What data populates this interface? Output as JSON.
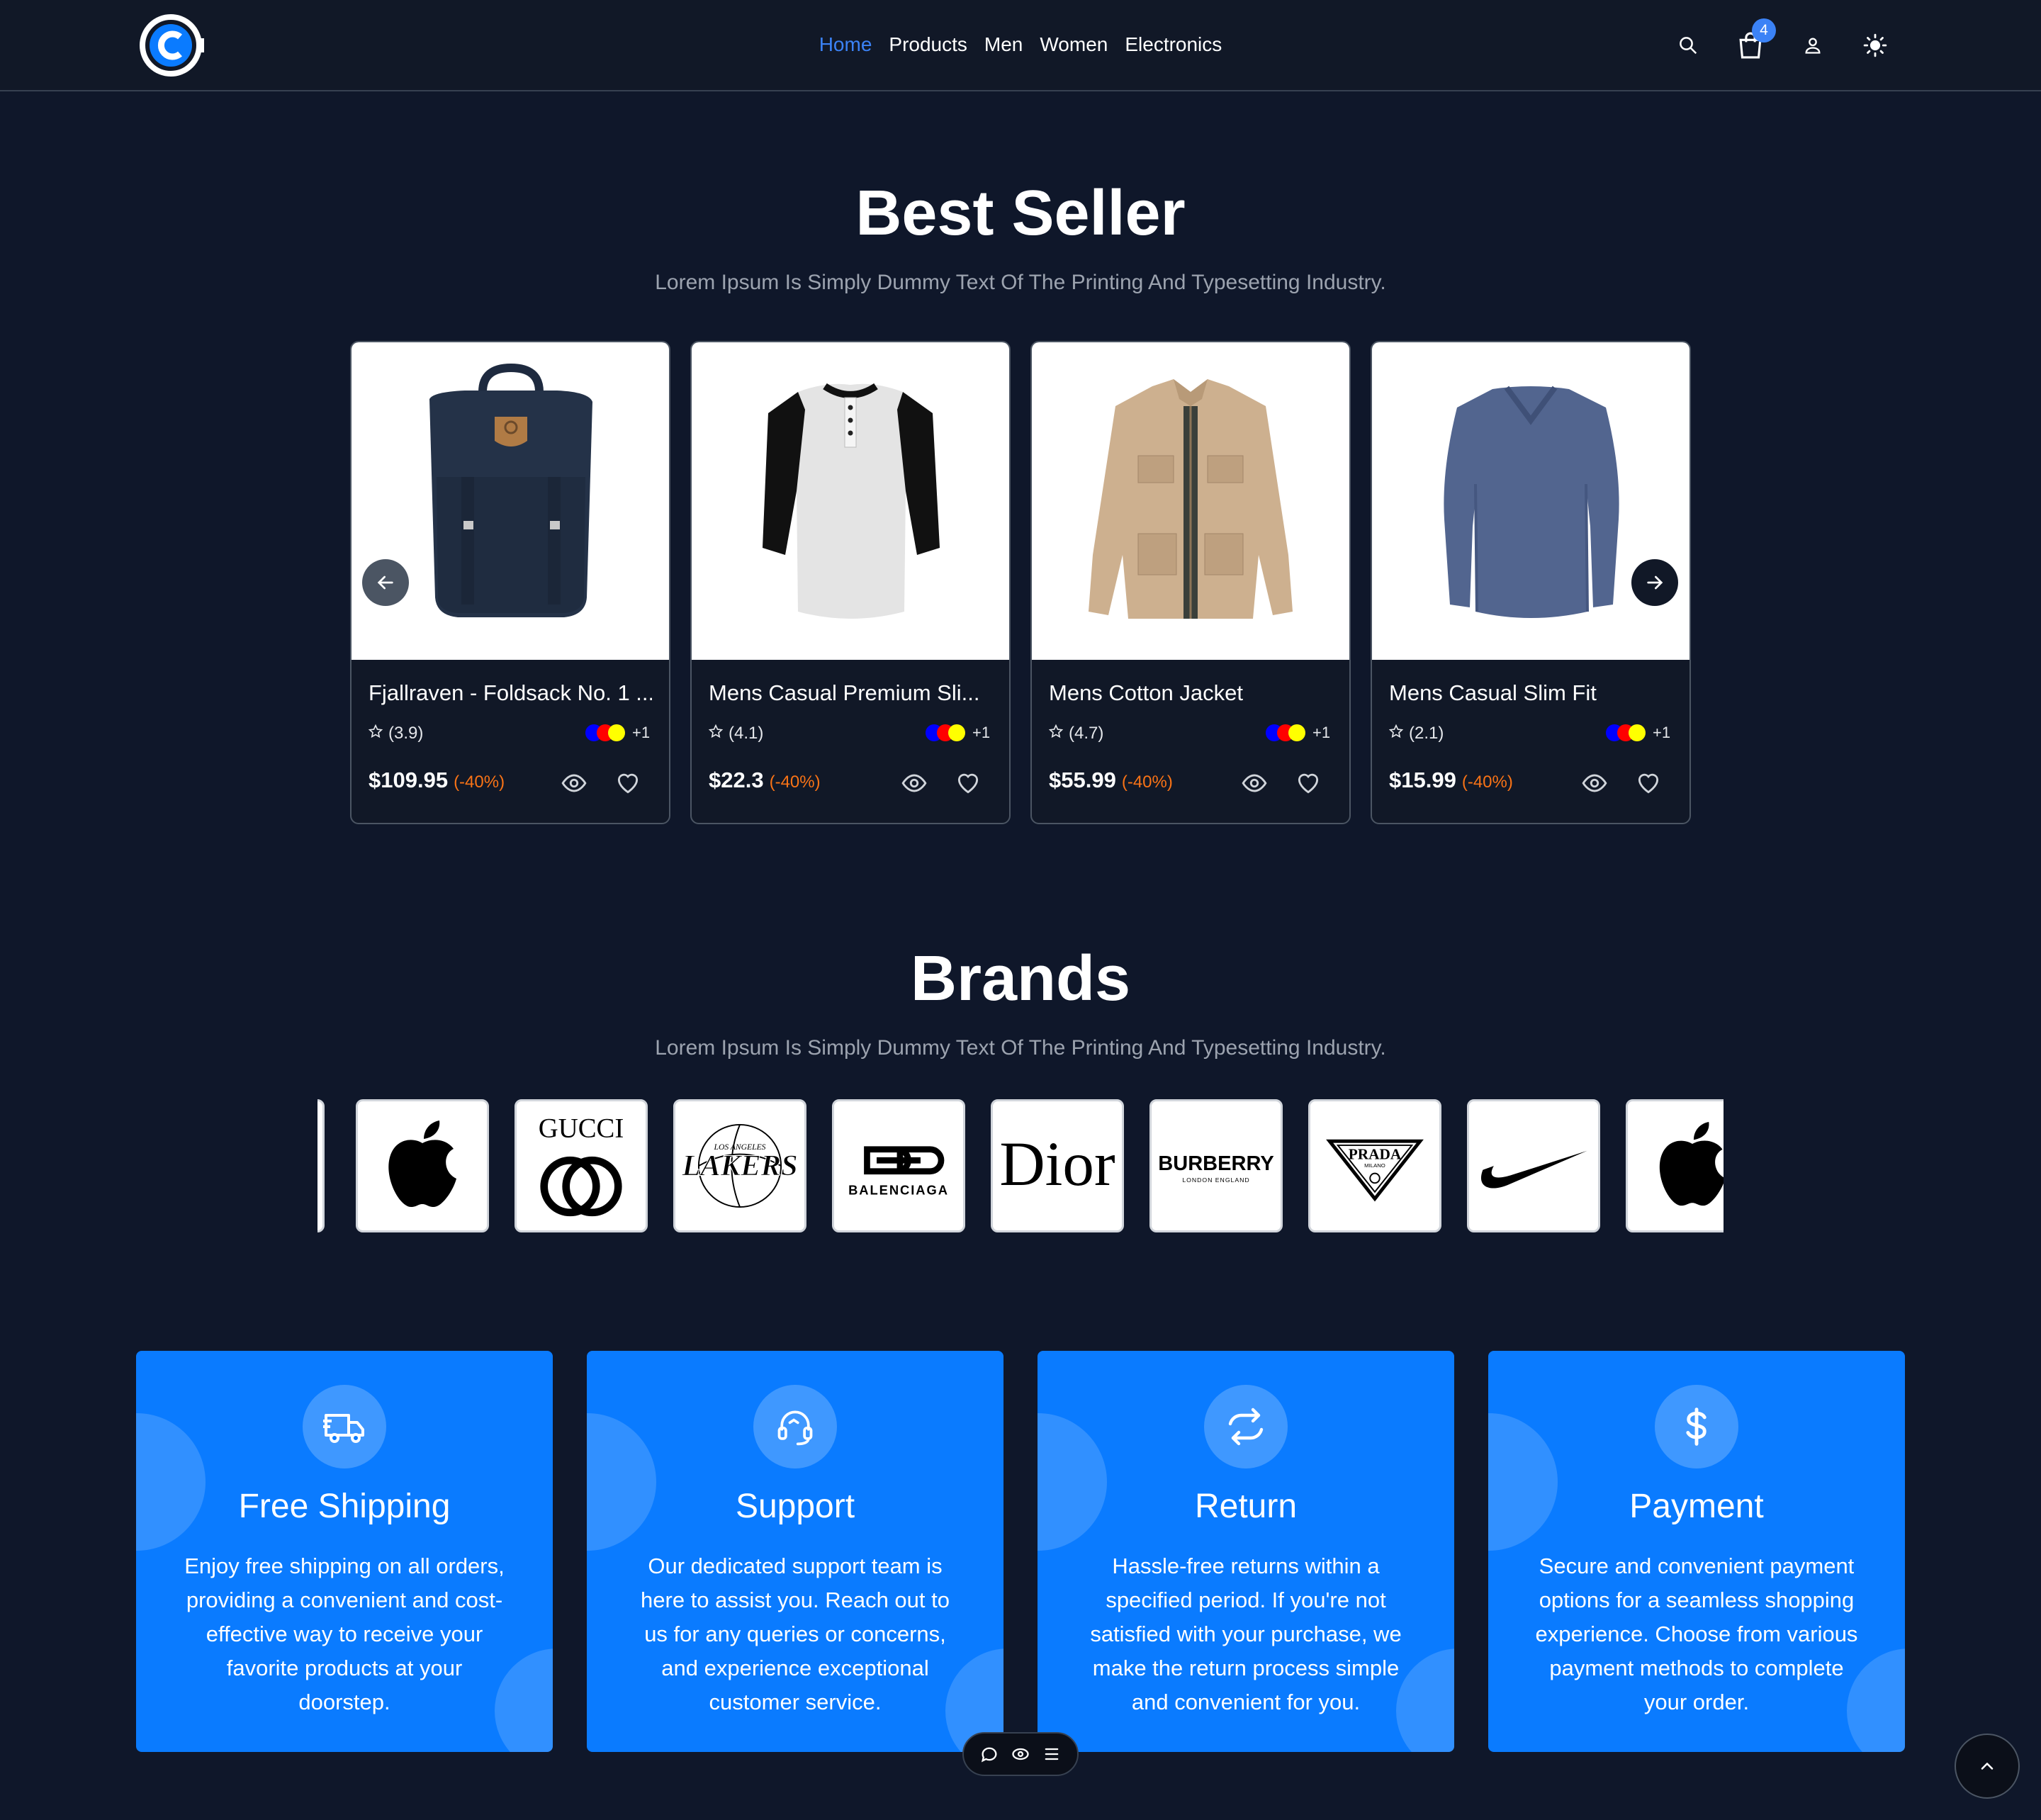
{
  "header": {
    "nav": [
      "Home",
      "Products",
      "Men",
      "Women",
      "Electronics"
    ],
    "active_nav": "Home",
    "cart_count": "4",
    "accent": "#3b82f6"
  },
  "best_seller": {
    "title": "Best Seller",
    "subtitle": "Lorem Ipsum Is Simply Dummy Text Of The Printing And Typesetting Industry.",
    "products": [
      {
        "name": "Fjallraven - Foldsack No. 1 ...",
        "rating": "(3.9)",
        "price": "$109.95",
        "discount": "(-40%)",
        "more_colors": "+1"
      },
      {
        "name": "Mens Casual Premium Sli...",
        "rating": "(4.1)",
        "price": "$22.3",
        "discount": "(-40%)",
        "more_colors": "+1"
      },
      {
        "name": "Mens Cotton Jacket",
        "rating": "(4.7)",
        "price": "$55.99",
        "discount": "(-40%)",
        "more_colors": "+1"
      },
      {
        "name": "Mens Casual Slim Fit",
        "rating": "(2.1)",
        "price": "$15.99",
        "discount": "(-40%)",
        "more_colors": "+1"
      }
    ],
    "swatch_colors": [
      "#0000ff",
      "#ff0000",
      "#ffff00"
    ],
    "discount_color": "#f97316"
  },
  "brands": {
    "title": "Brands",
    "subtitle": "Lorem Ipsum Is Simply Dummy Text Of The Printing And Typesetting Industry.",
    "logos": [
      "apple-logo",
      "gucci-logo",
      "lakers-logo",
      "balenciaga-logo",
      "dior-logo",
      "burberry-logo",
      "prada-logo",
      "nike-logo",
      "apple-logo"
    ],
    "text": {
      "gucci": "GUCCI",
      "lakers_top": "LOS ANGELES",
      "lakers": "LAKERS",
      "balenciaga": "BALENCIAGA",
      "dior": "Dior",
      "burberry": "BURBERRY",
      "burberry_sub": "LONDON ENGLAND",
      "prada": "PRADA",
      "prada_sub": "MILANO"
    }
  },
  "features": [
    {
      "title": "Free Shipping",
      "text": "Enjoy free shipping on all orders, providing a convenient and cost-effective way to receive your favorite products at your doorstep.",
      "icon": "truck-icon"
    },
    {
      "title": "Support",
      "text": "Our dedicated support team is here to assist you. Reach out to us for any queries or concerns, and experience exceptional customer service.",
      "icon": "headset-icon"
    },
    {
      "title": "Return",
      "text": "Hassle-free returns within a specified period. If you're not satisfied with your purchase, we make the return process simple and convenient for you.",
      "icon": "refresh-icon"
    },
    {
      "title": "Payment",
      "text": "Secure and convenient payment options for a seamless shopping experience. Choose from various payment methods to complete your order.",
      "icon": "dollar-icon"
    }
  ],
  "colors": {
    "background": "#0f172a",
    "feature_blue": "#0a7bff"
  }
}
